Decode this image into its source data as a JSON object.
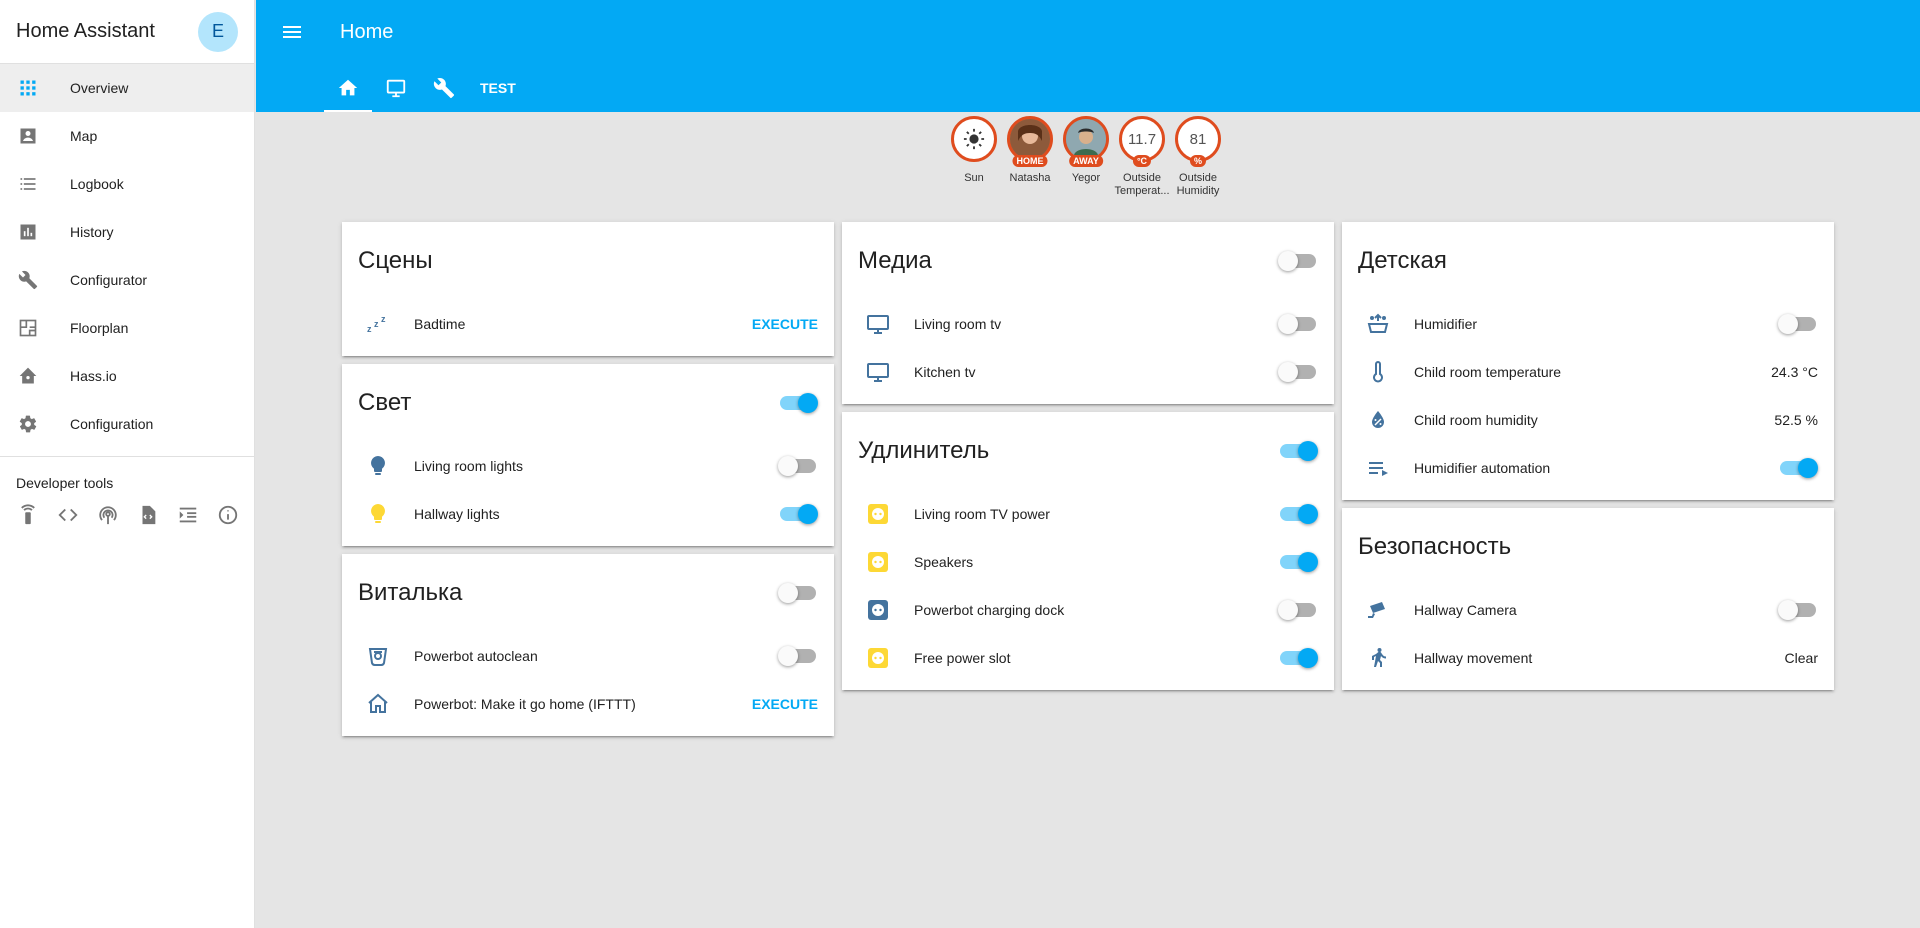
{
  "app": {
    "title": "Home Assistant",
    "user_initial": "E"
  },
  "sidebar": {
    "items": [
      {
        "label": "Overview",
        "icon": "grid-icon"
      },
      {
        "label": "Map",
        "icon": "account-box-icon"
      },
      {
        "label": "Logbook",
        "icon": "list-icon"
      },
      {
        "label": "History",
        "icon": "chart-icon"
      },
      {
        "label": "Configurator",
        "icon": "wrench-icon"
      },
      {
        "label": "Floorplan",
        "icon": "floorplan-icon"
      },
      {
        "label": "Hass.io",
        "icon": "hassio-icon"
      },
      {
        "label": "Configuration",
        "icon": "gear-icon"
      }
    ],
    "dev_tools_title": "Developer tools",
    "dev_tools": [
      "remote-icon",
      "code-icon",
      "mqtt-icon",
      "template-icon",
      "events-icon",
      "info-icon"
    ]
  },
  "header": {
    "title": "Home",
    "tabs": [
      {
        "icon": "home-icon",
        "active": true
      },
      {
        "icon": "monitor-icon"
      },
      {
        "icon": "wrench-icon"
      },
      {
        "label": "TEST"
      }
    ]
  },
  "badges": [
    {
      "label": "Sun",
      "icon": "sun-icon"
    },
    {
      "label": "Natasha",
      "tag": "HOME"
    },
    {
      "label": "Yegor",
      "tag": "AWAY"
    },
    {
      "label": "Outside Temperat...",
      "value": "11.7",
      "tag": "°C"
    },
    {
      "label": "Outside Humidity",
      "value": "81",
      "tag": "%"
    }
  ],
  "cards": {
    "scenes": {
      "title": "Сцены",
      "rows": [
        {
          "name": "Badtime",
          "action": "EXECUTE",
          "icon": "sleep-icon"
        }
      ]
    },
    "light": {
      "title": "Свет",
      "toggle": true,
      "rows": [
        {
          "name": "Living room lights",
          "on": false,
          "icon": "bulb-icon"
        },
        {
          "name": "Hallway lights",
          "on": true,
          "icon": "bulb-icon"
        }
      ]
    },
    "vitalka": {
      "title": "Виталька",
      "toggle": false,
      "rows": [
        {
          "name": "Powerbot autoclean",
          "on": false,
          "icon": "robot-vacuum-icon"
        },
        {
          "name": "Powerbot: Make it go home (IFTTT)",
          "action": "EXECUTE",
          "icon": "home-outline-icon"
        }
      ]
    },
    "media": {
      "title": "Медиа",
      "toggle": false,
      "rows": [
        {
          "name": "Living room tv",
          "on": false,
          "icon": "monitor-icon"
        },
        {
          "name": "Kitchen tv",
          "on": false,
          "icon": "monitor-icon"
        }
      ]
    },
    "extender": {
      "title": "Удлинитель",
      "toggle": true,
      "rows": [
        {
          "name": "Living room TV power",
          "on": true,
          "icon": "power-socket-icon"
        },
        {
          "name": "Speakers",
          "on": true,
          "icon": "power-socket-icon"
        },
        {
          "name": "Powerbot charging dock",
          "on": false,
          "icon": "power-socket-icon"
        },
        {
          "name": "Free power slot",
          "on": true,
          "icon": "power-socket-icon"
        }
      ]
    },
    "kids": {
      "title": "Детская",
      "rows": [
        {
          "name": "Humidifier",
          "on": false,
          "icon": "humidifier-icon"
        },
        {
          "name": "Child room temperature",
          "state": "24.3 °C",
          "icon": "thermometer-icon"
        },
        {
          "name": "Child room humidity",
          "state": "52.5 %",
          "icon": "water-percent-icon"
        },
        {
          "name": "Humidifier automation",
          "on": true,
          "icon": "automation-icon"
        }
      ]
    },
    "security": {
      "title": "Безопасность",
      "rows": [
        {
          "name": "Hallway Camera",
          "on": false,
          "icon": "cctv-icon"
        },
        {
          "name": "Hallway movement",
          "state": "Clear",
          "icon": "walk-icon"
        }
      ]
    }
  },
  "colors": {
    "accent": "#03a9f4",
    "badge_border": "#df4c1e",
    "icon_blue": "#44739e",
    "icon_yellow": "#fdd835"
  }
}
